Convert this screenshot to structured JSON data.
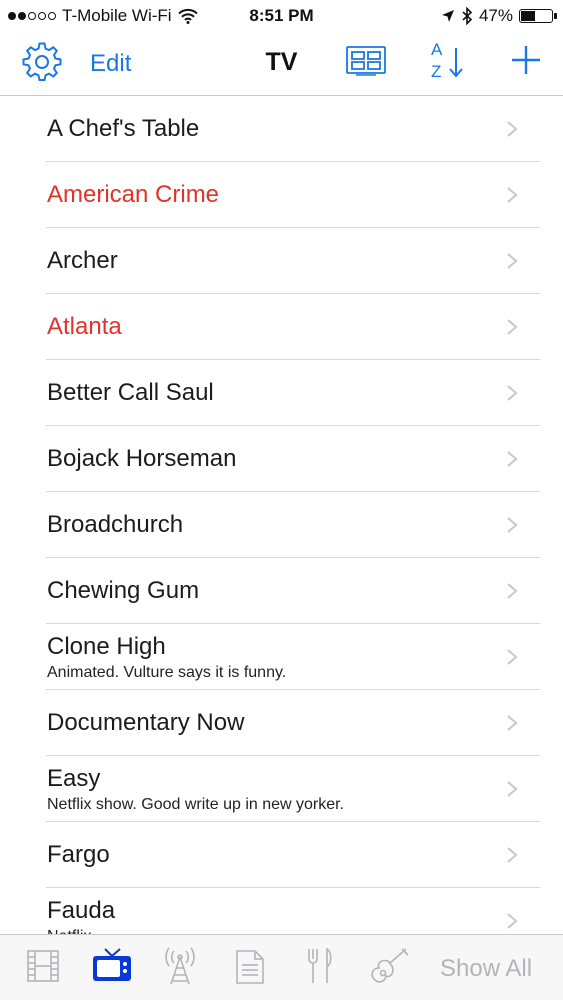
{
  "status": {
    "carrier": "T-Mobile Wi-Fi",
    "time": "8:51 PM",
    "battery": "47%",
    "battery_level": 0.47,
    "signal_bars_filled": 2,
    "signal_bars_total": 5
  },
  "nav": {
    "edit_label": "Edit",
    "title": "TV",
    "sort_top": "A",
    "sort_bottom": "Z",
    "accent": "#1a78e6"
  },
  "items": [
    {
      "title": "A Chef's Table",
      "note": "",
      "highlight": false
    },
    {
      "title": "American Crime",
      "note": "",
      "highlight": true
    },
    {
      "title": "Archer",
      "note": "",
      "highlight": false
    },
    {
      "title": "Atlanta",
      "note": "",
      "highlight": true
    },
    {
      "title": "Better Call Saul",
      "note": "",
      "highlight": false
    },
    {
      "title": "Bojack Horseman",
      "note": "",
      "highlight": false
    },
    {
      "title": "Broadchurch",
      "note": "",
      "highlight": false
    },
    {
      "title": "Chewing Gum",
      "note": "",
      "highlight": false
    },
    {
      "title": "Clone High",
      "note": "Animated. Vulture says it is funny.",
      "highlight": false
    },
    {
      "title": "Documentary Now",
      "note": "",
      "highlight": false
    },
    {
      "title": "Easy",
      "note": "Netflix show. Good write up in new yorker.",
      "highlight": false
    },
    {
      "title": "Fargo",
      "note": "",
      "highlight": false
    },
    {
      "title": "Fauda",
      "note": "Netflix",
      "highlight": false
    }
  ],
  "highlight_color": "#e0342b",
  "tabbar": {
    "tabs": [
      {
        "icon": "film-icon",
        "selected": false
      },
      {
        "icon": "tv-icon",
        "selected": true
      },
      {
        "icon": "radio-tower-icon",
        "selected": false
      },
      {
        "icon": "document-icon",
        "selected": false
      },
      {
        "icon": "fork-knife-icon",
        "selected": false
      },
      {
        "icon": "guitar-icon",
        "selected": false
      }
    ],
    "show_all_label": "Show All",
    "selected_color": "#0a3ad6"
  }
}
